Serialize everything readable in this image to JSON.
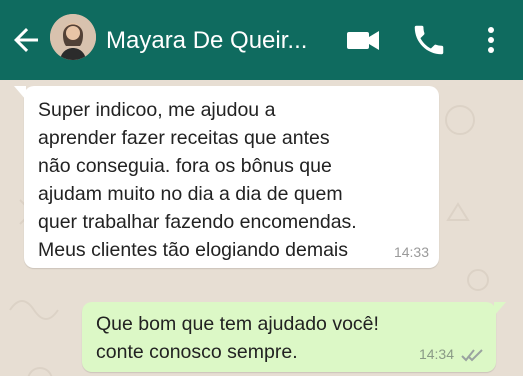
{
  "header": {
    "title": "Mayara De Queir...",
    "icons": {
      "back": "back-arrow-icon",
      "video": "video-call-icon",
      "call": "phone-icon",
      "menu": "more-vert-icon"
    },
    "colors": {
      "bar": "#0f6b5f",
      "icon": "#ffffff"
    }
  },
  "chat": {
    "background": "#e7ded3",
    "messages": [
      {
        "direction": "incoming",
        "text": "Super indicoo, me ajudou a\naprender fazer receitas que antes\nnão conseguia. fora os bônus que\najudam muito no dia a dia de quem\nquer trabalhar fazendo encomendas.\nMeus clientes tão elogiando demais",
        "time": "14:33",
        "bubble_color": "#ffffff"
      },
      {
        "direction": "outgoing",
        "text": "Que bom que tem ajudado você!\nconte conosco sempre.",
        "time": "14:34",
        "status_icon": "double-check-icon",
        "bubble_color": "#dcf8c6"
      }
    ]
  }
}
